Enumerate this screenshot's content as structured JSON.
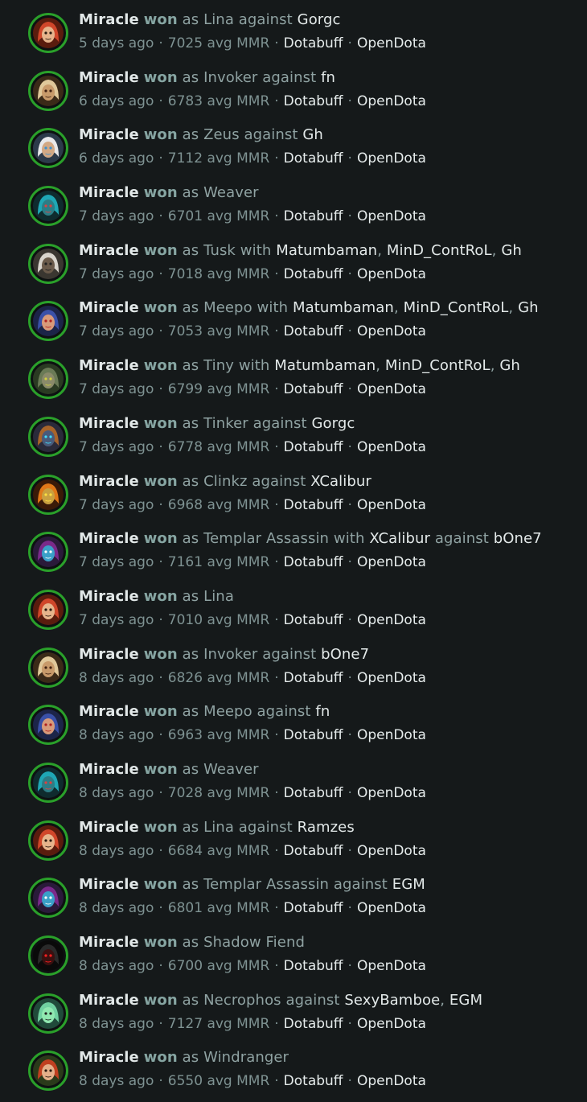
{
  "player": "Miracle",
  "result": "won",
  "words": {
    "as": "as",
    "with": "with",
    "against": "against",
    "avg_mmr": "avg MMR"
  },
  "links": {
    "dotabuff": "Dotabuff",
    "opendota": "OpenDota"
  },
  "separator": "·",
  "matches": [
    {
      "hero": "Lina",
      "hero_icon": "lina-hero-icon",
      "with": [],
      "against": [
        "Gorgc"
      ],
      "time": "5 days ago",
      "mmr": "7025"
    },
    {
      "hero": "Invoker",
      "hero_icon": "invoker-hero-icon",
      "with": [],
      "against": [
        "fn"
      ],
      "time": "6 days ago",
      "mmr": "6783"
    },
    {
      "hero": "Zeus",
      "hero_icon": "zeus-hero-icon",
      "with": [],
      "against": [
        "Gh"
      ],
      "time": "6 days ago",
      "mmr": "7112"
    },
    {
      "hero": "Weaver",
      "hero_icon": "weaver-hero-icon",
      "with": [],
      "against": [],
      "time": "7 days ago",
      "mmr": "6701"
    },
    {
      "hero": "Tusk",
      "hero_icon": "tusk-hero-icon",
      "with": [
        "Matumbaman",
        "MinD_ContRoL",
        "Gh"
      ],
      "against": [],
      "time": "7 days ago",
      "mmr": "7018"
    },
    {
      "hero": "Meepo",
      "hero_icon": "meepo-hero-icon",
      "with": [
        "Matumbaman",
        "MinD_ContRoL",
        "Gh"
      ],
      "against": [],
      "time": "7 days ago",
      "mmr": "7053"
    },
    {
      "hero": "Tiny",
      "hero_icon": "tiny-hero-icon",
      "with": [
        "Matumbaman",
        "MinD_ContRoL",
        "Gh"
      ],
      "against": [],
      "time": "7 days ago",
      "mmr": "6799"
    },
    {
      "hero": "Tinker",
      "hero_icon": "tinker-hero-icon",
      "with": [],
      "against": [
        "Gorgc"
      ],
      "time": "7 days ago",
      "mmr": "6778"
    },
    {
      "hero": "Clinkz",
      "hero_icon": "clinkz-hero-icon",
      "with": [],
      "against": [
        "XCalibur"
      ],
      "time": "7 days ago",
      "mmr": "6968"
    },
    {
      "hero": "Templar Assassin",
      "hero_icon": "templar-assassin-hero-icon",
      "with": [
        "XCalibur"
      ],
      "against": [
        "bOne7"
      ],
      "time": "7 days ago",
      "mmr": "7161"
    },
    {
      "hero": "Lina",
      "hero_icon": "lina-hero-icon",
      "with": [],
      "against": [],
      "time": "7 days ago",
      "mmr": "7010"
    },
    {
      "hero": "Invoker",
      "hero_icon": "invoker-hero-icon",
      "with": [],
      "against": [
        "bOne7"
      ],
      "time": "8 days ago",
      "mmr": "6826"
    },
    {
      "hero": "Meepo",
      "hero_icon": "meepo-hero-icon",
      "with": [],
      "against": [
        "fn"
      ],
      "time": "8 days ago",
      "mmr": "6963"
    },
    {
      "hero": "Weaver",
      "hero_icon": "weaver-hero-icon",
      "with": [],
      "against": [],
      "time": "8 days ago",
      "mmr": "7028"
    },
    {
      "hero": "Lina",
      "hero_icon": "lina-hero-icon",
      "with": [],
      "against": [
        "Ramzes"
      ],
      "time": "8 days ago",
      "mmr": "6684"
    },
    {
      "hero": "Templar Assassin",
      "hero_icon": "templar-assassin-hero-icon",
      "with": [],
      "against": [
        "EGM"
      ],
      "time": "8 days ago",
      "mmr": "6801"
    },
    {
      "hero": "Shadow Fiend",
      "hero_icon": "shadow-fiend-hero-icon",
      "with": [],
      "against": [],
      "time": "8 days ago",
      "mmr": "6700"
    },
    {
      "hero": "Necrophos",
      "hero_icon": "necrophos-hero-icon",
      "with": [],
      "against": [
        "SexyBamboe",
        "EGM"
      ],
      "time": "8 days ago",
      "mmr": "7127"
    },
    {
      "hero": "Windranger",
      "hero_icon": "windranger-hero-icon",
      "with": [],
      "against": [],
      "time": "8 days ago",
      "mmr": "6550"
    }
  ],
  "colors": {
    "background": "#15191a",
    "avatar_ring": "#2aa02a",
    "won": "#86a5a2",
    "player": "#e2e8e8",
    "muted": "#7e9292"
  }
}
